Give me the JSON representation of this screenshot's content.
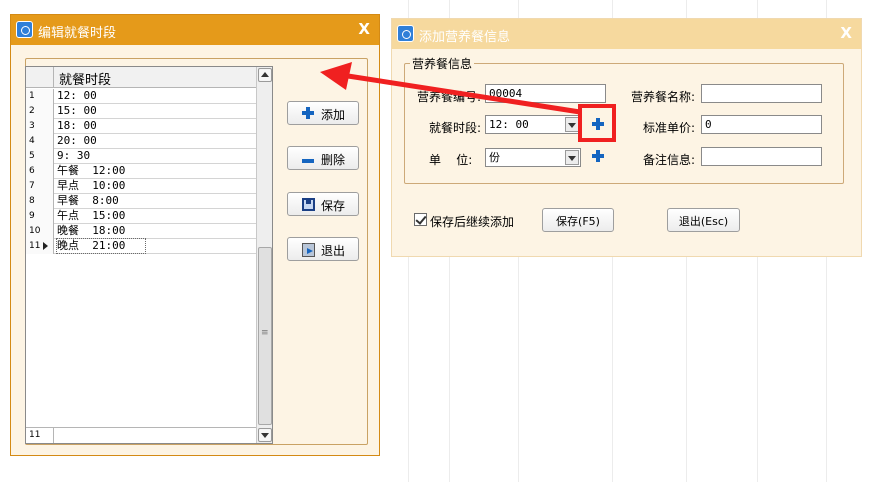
{
  "edit_dialog": {
    "title": "编辑就餐时段",
    "close_label": "X",
    "grid": {
      "column_header": "就餐时段",
      "rows": [
        {
          "num": "1",
          "value": "12: 00"
        },
        {
          "num": "2",
          "value": "15: 00"
        },
        {
          "num": "3",
          "value": "18: 00"
        },
        {
          "num": "4",
          "value": "20: 00"
        },
        {
          "num": "5",
          "value": "9: 30"
        },
        {
          "num": "6",
          "value": "午餐  12:00"
        },
        {
          "num": "7",
          "value": "早点  10:00"
        },
        {
          "num": "8",
          "value": "早餐  8:00"
        },
        {
          "num": "9",
          "value": "午点  15:00"
        },
        {
          "num": "10",
          "value": "晚餐  18:00"
        },
        {
          "num": "11",
          "value": "晚点  21:00"
        }
      ],
      "footer_count": "11"
    },
    "buttons": {
      "add": "添加",
      "delete": "删除",
      "save": "保存",
      "exit": "退出"
    }
  },
  "add_dialog": {
    "title": "添加营养餐信息",
    "close_label": "X",
    "group_title": "营养餐信息",
    "fields": {
      "code_label": "营养餐编号:",
      "code_value": "00004",
      "name_label": "营养餐名称:",
      "name_value": "",
      "period_label": "就餐时段:",
      "period_value": "12: 00",
      "price_label": "标准单价:",
      "price_value": "0",
      "unit_label": "单    位:",
      "unit_value": "份",
      "note_label": "备注信息:",
      "note_value": ""
    },
    "continue_label": "保存后继续添加",
    "save_button": "保存(F5)",
    "exit_button": "退出(Esc)"
  },
  "colors": {
    "title_orange": "#e59a1a",
    "window_bg": "#fdf4e4",
    "accent_blue": "#1565c0",
    "highlight_red": "#f02020"
  }
}
